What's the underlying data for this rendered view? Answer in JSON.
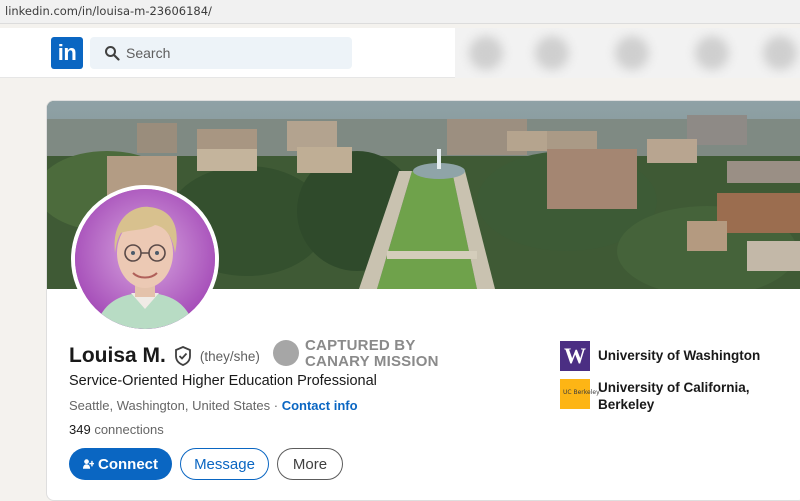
{
  "browser": {
    "url": "linkedin.com/in/louisa-m-23606184/"
  },
  "nav": {
    "logo_text": "in",
    "search_placeholder": "Search"
  },
  "profile": {
    "name": "Louisa M.",
    "pronouns": "(they/she)",
    "headline": "Service-Oriented Higher Education Professional",
    "location": "Seattle, Washington, United States",
    "separator": " · ",
    "contact_info_label": "Contact info",
    "connections_count": "349",
    "connections_label": " connections"
  },
  "stamp": {
    "line1": "CAPTURED BY",
    "line2": "CANARY MISSION"
  },
  "buttons": {
    "connect": "Connect",
    "message": "Message",
    "more": "More"
  },
  "education": [
    {
      "logo_text": "W",
      "name": "University of Washington",
      "logo_color": "#4b2e83"
    },
    {
      "logo_text": "UC Berkeley",
      "name": "University of California, Berkeley",
      "logo_color": "#fdb515"
    }
  ],
  "colors": {
    "brand": "#0a66c2",
    "background": "#f4f2ee"
  }
}
